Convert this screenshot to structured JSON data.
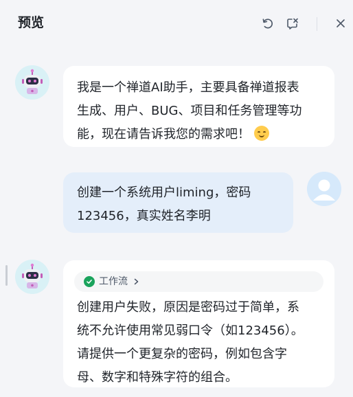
{
  "header": {
    "title": "预览",
    "refresh_icon": "refresh-icon",
    "clear_icon": "clear-chat-icon",
    "close_icon": "close-icon"
  },
  "messages": [
    {
      "role": "assistant",
      "avatar_icon": "robot-avatar-icon",
      "lines": [
        "我是一个禅道AI助手，主要具备禅道报表",
        "生成、用户、BUG、项目和任务管理等功",
        "能，现在请告诉我您的需求吧！"
      ],
      "emoji_icon": "hugging-face-emoji-icon"
    },
    {
      "role": "user",
      "avatar_icon": "user-avatar-icon",
      "lines": [
        "创建一个系统用户liming，密码",
        "123456，真实姓名李明"
      ]
    },
    {
      "role": "assistant",
      "avatar_icon": "robot-avatar-icon",
      "workflow_label": "工作流",
      "workflow_status_icon": "success-check-icon",
      "lines": [
        "创建用户失败，原因是密码过于简单，系",
        "统不允许使用常见弱口令（如123456）。",
        "请提供一个更复杂的密码，例如包含字",
        "母、数字和特殊字符的组合。"
      ]
    }
  ],
  "colors": {
    "background": "#f4f5f8",
    "assistant_bubble": "#ffffff",
    "user_bubble": "#e4eefa",
    "success": "#1aa35c"
  }
}
